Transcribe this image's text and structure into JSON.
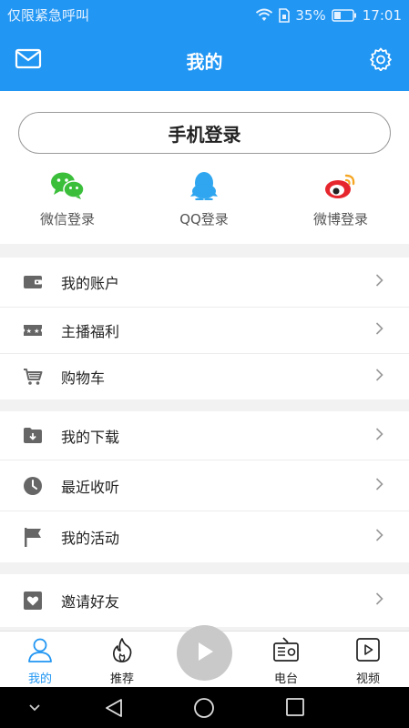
{
  "status_bar": {
    "carrier": "仅限紧急呼叫",
    "battery": "35%",
    "time": "17:01"
  },
  "header": {
    "title": "我的"
  },
  "login": {
    "phone_label": "手机登录",
    "social": [
      {
        "label": "微信登录",
        "icon": "wechat-icon",
        "color": "#3bbf3b"
      },
      {
        "label": "QQ登录",
        "icon": "qq-icon",
        "color": "#2fa6ef"
      },
      {
        "label": "微博登录",
        "icon": "weibo-icon",
        "color": "#e6262d"
      }
    ]
  },
  "menu_groups": [
    [
      {
        "label": "我的账户",
        "icon": "wallet-icon"
      },
      {
        "label": "主播福利",
        "icon": "ticket-icon"
      },
      {
        "label": "购物车",
        "icon": "cart-icon"
      }
    ],
    [
      {
        "label": "我的下载",
        "icon": "download-folder-icon"
      },
      {
        "label": "最近收听",
        "icon": "clock-icon"
      },
      {
        "label": "我的活动",
        "icon": "flag-icon"
      }
    ],
    [
      {
        "label": "邀请好友",
        "icon": "invite-icon"
      }
    ]
  ],
  "tabs": [
    {
      "label": "我的",
      "icon": "person-icon",
      "active": true
    },
    {
      "label": "推荐",
      "icon": "flame-icon",
      "active": false
    },
    {
      "label": "",
      "icon": "play-icon",
      "active": false
    },
    {
      "label": "电台",
      "icon": "radio-icon",
      "active": false
    },
    {
      "label": "视频",
      "icon": "video-icon",
      "active": false
    }
  ],
  "colors": {
    "primary": "#2196f3",
    "text": "#222222",
    "secondary_text": "#555555",
    "icon_gray": "#666666"
  }
}
